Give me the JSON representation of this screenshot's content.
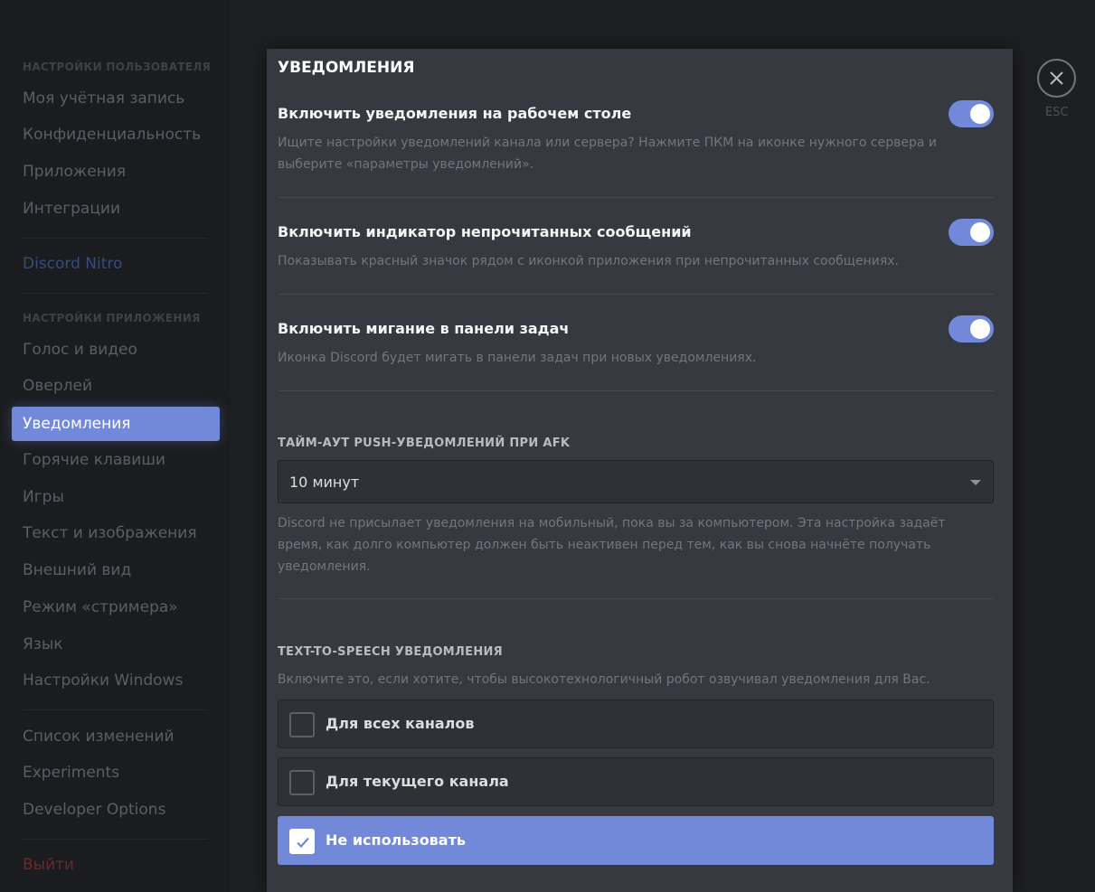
{
  "sidebar": {
    "user_header": "Настройки пользователя",
    "user_items": [
      "Моя учётная запись",
      "Конфиденциальность",
      "Приложения",
      "Интеграции"
    ],
    "nitro": "Discord Nitro",
    "app_header": "Настройки приложения",
    "app_items": [
      "Голос и видео",
      "Оверлей",
      "Уведомления",
      "Горячие клавиши",
      "Игры",
      "Текст и изображения",
      "Внешний вид",
      "Режим «стримера»",
      "Язык",
      "Настройки Windows"
    ],
    "misc_items": [
      "Список изменений",
      "Experiments",
      "Developer Options"
    ],
    "logout": "Выйти",
    "active": "Уведомления"
  },
  "main": {
    "title": "Уведомления",
    "options": [
      {
        "title": "Включить уведомления на рабочем столе",
        "desc": "Ищите настройки уведомлений канала или сервера? Нажмите ПКМ на иконке нужного сервера и выберите «параметры уведомлений».",
        "enabled": true
      },
      {
        "title": "Включить индикатор непрочитанных сообщений",
        "desc": "Показывать красный значок рядом с иконкой приложения при непрочитанных сообщениях.",
        "enabled": true
      },
      {
        "title": "Включить мигание в панели задач",
        "desc": "Иконка Discord будет мигать в панели задач при новых уведомлениях.",
        "enabled": true
      }
    ],
    "afk": {
      "label": "Тайм-аут push-уведомлений при AFK",
      "value": "10 минут",
      "desc": "Discord не присылает уведомления на мобильный, пока вы за компьютером. Эта настройка задаёт время, как долго компьютер должен быть неактивен перед тем, как вы снова начнёте получать уведомления."
    },
    "tts": {
      "label": "Text-to-Speech уведомления",
      "desc": "Включите это, если хотите, чтобы высокотехнологичный робот озвучивал уведомления для Вас.",
      "options": [
        "Для всех каналов",
        "Для текущего канала",
        "Не использовать"
      ],
      "selected": "Не использовать"
    }
  },
  "close": {
    "label": "ESC",
    "icon": "close-icon"
  },
  "colors": {
    "accent": "#7289da",
    "background": "#36393f",
    "sidebar": "#1b1c1f"
  }
}
